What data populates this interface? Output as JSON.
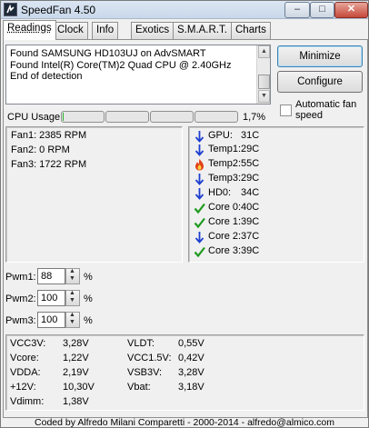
{
  "window": {
    "title": "SpeedFan 4.50"
  },
  "window_buttons": {
    "minimize": "–",
    "maximize": "□",
    "close": "✕"
  },
  "tabs": [
    {
      "label": "Readings",
      "active": true
    },
    {
      "label": "Clock"
    },
    {
      "label": "Info"
    },
    {
      "label": "Exotics"
    },
    {
      "label": "S.M.A.R.T."
    },
    {
      "label": "Charts"
    }
  ],
  "log_lines": [
    "Found SAMSUNG HD103UJ on AdvSMART",
    "Found Intel(R) Core(TM)2 Quad CPU @ 2.40GHz",
    "End of detection"
  ],
  "buttons": {
    "minimize": "Minimize",
    "configure": "Configure"
  },
  "auto_fan": {
    "label": "Automatic fan speed",
    "checked": false
  },
  "cpu_usage": {
    "label": "CPU Usage",
    "percent_text": "1,7%",
    "bars": [
      0.03,
      0,
      0,
      0
    ]
  },
  "fans": [
    "Fan1: 2385 RPM",
    "Fan2: 0 RPM",
    "Fan3: 1722 RPM"
  ],
  "temps": [
    {
      "label": "GPU:",
      "value": "31C",
      "icon": "arrow-down-icon"
    },
    {
      "label": "Temp1:",
      "value": "29C",
      "icon": "arrow-down-icon"
    },
    {
      "label": "Temp2:",
      "value": "55C",
      "icon": "flame-icon"
    },
    {
      "label": "Temp3:",
      "value": "29C",
      "icon": "arrow-down-icon"
    },
    {
      "label": "HD0:",
      "value": "34C",
      "icon": "arrow-down-icon"
    },
    {
      "label": "Core 0:",
      "value": "40C",
      "icon": "checkmark-icon"
    },
    {
      "label": "Core 1:",
      "value": "39C",
      "icon": "checkmark-icon"
    },
    {
      "label": "Core 2:",
      "value": "37C",
      "icon": "arrow-down-icon"
    },
    {
      "label": "Core 3:",
      "value": "39C",
      "icon": "checkmark-icon"
    }
  ],
  "pwm": [
    {
      "label": "Pwm1:",
      "value": "88",
      "unit": "%"
    },
    {
      "label": "Pwm2:",
      "value": "100",
      "unit": "%"
    },
    {
      "label": "Pwm3:",
      "value": "100",
      "unit": "%"
    }
  ],
  "voltages_left": [
    {
      "label": "VCC3V:",
      "value": "3,28V"
    },
    {
      "label": "Vcore:",
      "value": "1,22V"
    },
    {
      "label": "VDDA:",
      "value": "2,19V"
    },
    {
      "label": "+12V:",
      "value": "10,30V"
    },
    {
      "label": "Vdimm:",
      "value": "1,38V"
    }
  ],
  "voltages_right": [
    {
      "label": "VLDT:",
      "value": "0,55V"
    },
    {
      "label": "VCC1.5V:",
      "value": "0,42V"
    },
    {
      "label": "VSB3V:",
      "value": "3,28V"
    },
    {
      "label": "Vbat:",
      "value": "3,18V"
    }
  ],
  "footer": "Coded by Alfredo Milani Comparetti - 2000-2014 - alfredo@almico.com",
  "colors": {
    "arrow": "#1d3fd0",
    "flame": "#e0401a",
    "check": "#1e9a1e",
    "cpu_fill": "#26b326"
  }
}
